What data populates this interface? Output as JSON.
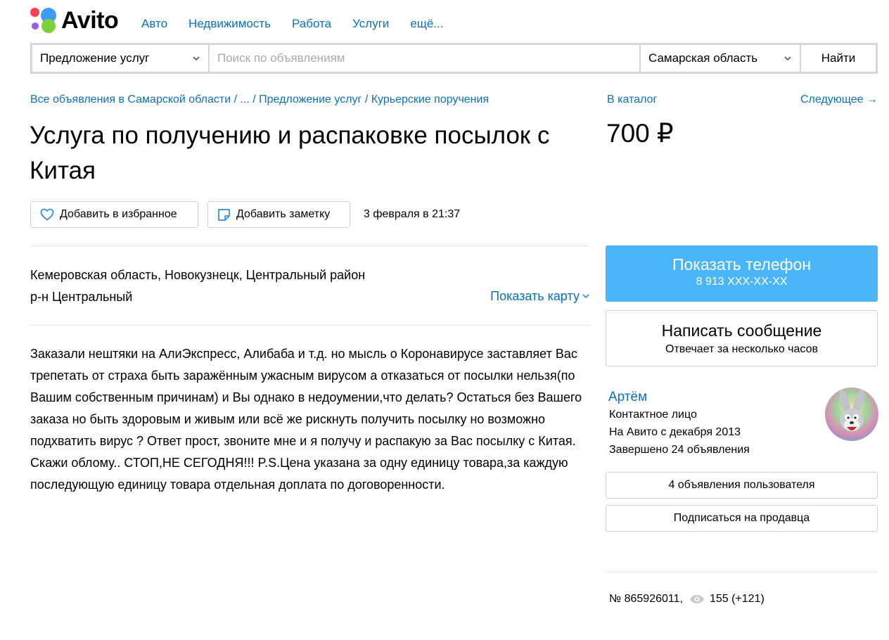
{
  "colors": {
    "link": "#0a6fc7",
    "accent_blue": "#4ab6f7",
    "logo_dots": [
      "#3d9cf6",
      "#ff4053",
      "#965eeb",
      "#80d03d"
    ]
  },
  "header": {
    "logo_text": "Avito",
    "nav": [
      "Авто",
      "Недвижимость",
      "Работа",
      "Услуги",
      "ещё..."
    ]
  },
  "search": {
    "category": "Предложение услуг",
    "placeholder": "Поиск по объявлениям",
    "region": "Самарская область",
    "submit_label": "Найти"
  },
  "breadcrumbs": "Все объявления в Самарской области / ... / Предложение услуг / Курьерские поручения",
  "catalog_link": "В каталог",
  "next_link": "Следующее →",
  "title": "Услуга по получению и распаковке посылок с Китая",
  "price": "700 ₽",
  "actions": {
    "favorite_label": "Добавить в избранное",
    "note_label": "Добавить заметку",
    "date": "3 февраля в 21:37"
  },
  "location": {
    "line1": "Кемеровская область, Новокузнецк, Центральный район",
    "line2": "р-н Центральный",
    "map_link": "Показать карту"
  },
  "description": "Заказали нештяки на АлиЭкспресс, Алибаба и т.д. но мысль о Коронавирусе заставляет Вас трепетать от страха быть заражённым ужасным вирусом а отказаться от посылки нельзя(по Вашим собственным причинам) и Вы однако в недоумении,что делать? Остаться без Вашего заказа но быть здоровым и живым или всё же рискнуть получить посылку но возможно подхватить вирус ? Ответ прост, звоните мне и я получу и распакую за Вас посылку с Китая. Скажи облому.. СТОП,НЕ СЕГОДНЯ!!! P.S.Цена указана за одну единицу товара,за каждую последующую единицу товара отдельная доплата по договоренности.",
  "contact": {
    "phone_title": "Показать телефон",
    "phone_number": "8 913 XXX-XX-XX",
    "message_title": "Написать сообщение",
    "message_sub": "Отвечает за несколько часов"
  },
  "seller": {
    "name": "Артём",
    "role": "Контактное лицо",
    "since": "На Авито с декабря 2013",
    "completed": "Завершено 24 объявления",
    "listings_button": "4 объявления пользователя",
    "subscribe_button": "Подписаться на продавца"
  },
  "stats": {
    "ad_number": "№ 865926011,",
    "views": "155 (+121)"
  }
}
